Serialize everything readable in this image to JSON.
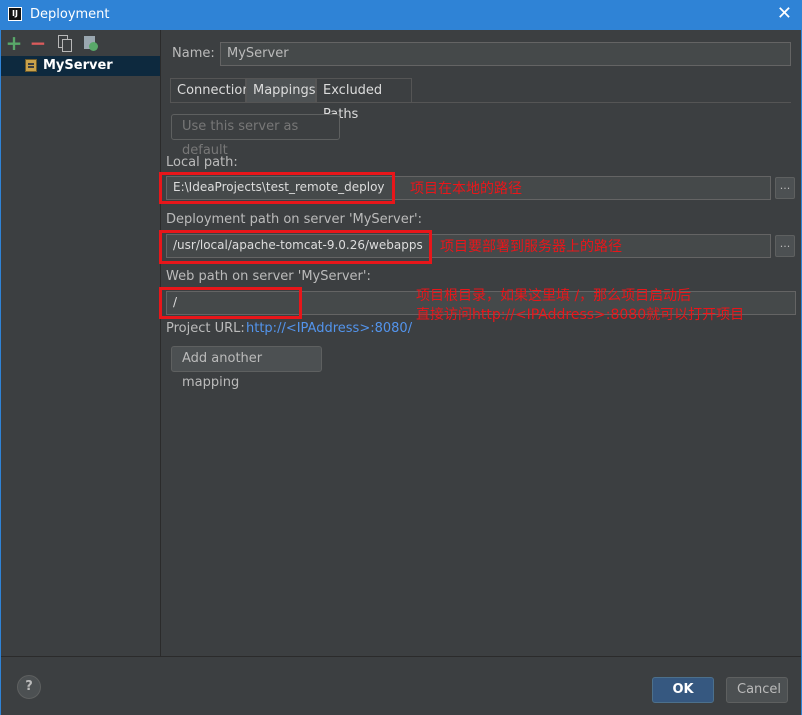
{
  "window": {
    "title": "Deployment",
    "app_icon": "IJ",
    "close_glyph": "✕"
  },
  "sidebar": {
    "toolbar": {
      "add": "+",
      "remove": "−",
      "copy": "copy-icon",
      "default": "set-default-icon"
    },
    "server": "MyServer"
  },
  "form": {
    "name_label": "Name:",
    "name_value": "MyServer",
    "tabs": [
      "Connection",
      "Mappings",
      "Excluded Paths"
    ],
    "active_tab": "Mappings",
    "use_default": "Use this server as default",
    "local_path_label": "Local path:",
    "local_path_value": "E:\\IdeaProjects\\test_remote_deploy",
    "deployment_label": "Deployment path on server 'MyServer':",
    "deployment_value": "/usr/local/apache-tomcat-9.0.26/webapps",
    "web_label": "Web path on server 'MyServer':",
    "web_value": "/",
    "browse": "...",
    "project_url_label": "Project URL:",
    "project_url": "http://<IPAddress>:8080/",
    "add_mapping": "Add another mapping"
  },
  "annotations": {
    "local": "项目在本地的路径",
    "deploy": "项目要部署到服务器上的路径",
    "web_line1": "项目根目录，如果这里填 /，那么项目启动后",
    "web_line2": "直接访问http://<IPAddress>:8080就可以打开项目",
    "color": "#e8161a"
  },
  "footer": {
    "help": "?",
    "ok": "OK",
    "cancel": "Cancel"
  },
  "colors": {
    "titlebar": "#2f83d6",
    "background": "#3c3f41",
    "selection": "#0d293e",
    "link": "#5394ec",
    "ok_button": "#365880"
  }
}
